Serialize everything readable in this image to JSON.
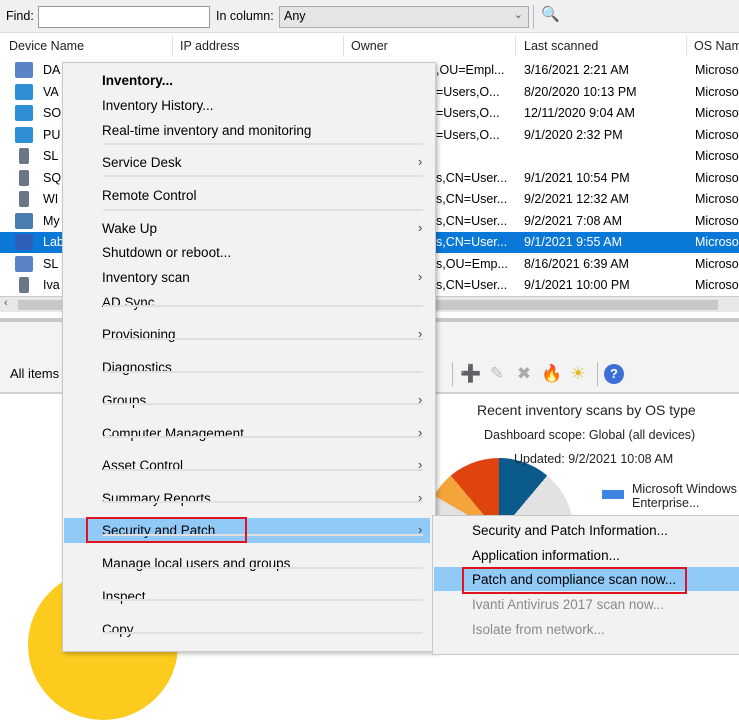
{
  "findbar": {
    "find_label": "Find:",
    "find_value": "",
    "column_label": "In column:",
    "column_value": "Any"
  },
  "columns": [
    "Device Name",
    "IP address",
    "Owner",
    "Last scanned",
    "OS Name"
  ],
  "rows": [
    {
      "name": "DA",
      "owner": ",OU=Empl...",
      "scanned": "3/16/2021 2:21 AM",
      "os": "Microsof",
      "icon": "laptop"
    },
    {
      "name": "VA",
      "owner": "=Users,O...",
      "scanned": "8/20/2020 10:13 PM",
      "os": "Microsof",
      "icon": "desktop"
    },
    {
      "name": "SO",
      "owner": "=Users,O...",
      "scanned": "12/11/2020 9:04 AM",
      "os": "Microsof",
      "icon": "desktop"
    },
    {
      "name": "PU",
      "owner": "=Users,O...",
      "scanned": "9/1/2020 2:32 PM",
      "os": "Microsof",
      "icon": "desktop"
    },
    {
      "name": "SL",
      "owner": "",
      "scanned": "",
      "os": "Microsof",
      "icon": "server"
    },
    {
      "name": "SQ",
      "owner": "s,CN=User...",
      "scanned": "9/1/2021 10:54 PM",
      "os": "Microsof",
      "icon": "server"
    },
    {
      "name": "WI",
      "owner": "s,CN=User...",
      "scanned": "9/2/2021 12:32 AM",
      "os": "Microsof",
      "icon": "server"
    },
    {
      "name": "My",
      "owner": "s,CN=User...",
      "scanned": "9/2/2021 7:08 AM",
      "os": "Microsof",
      "icon": "virtual"
    },
    {
      "name": "Lab",
      "owner": "s,CN=User...",
      "scanned": "9/1/2021 9:55 AM",
      "os": "Microsof",
      "icon": "network",
      "selected": true
    },
    {
      "name": "SL",
      "owner": "s,OU=Emp...",
      "scanned": "8/16/2021 6:39 AM",
      "os": "Microsof",
      "icon": "laptop"
    },
    {
      "name": "Iva",
      "owner": "s,CN=User...",
      "scanned": "9/1/2021 10:00 PM",
      "os": "Microsof",
      "icon": "server"
    }
  ],
  "toolbar": {
    "all_items": "All items"
  },
  "dashboard": {
    "title": "Recent inventory scans by OS type",
    "scope": "Dashboard scope: Global (all devices)",
    "updated": "Updated: 9/2/2021 10:08 AM",
    "legend": [
      "Microsoft Windows",
      "Enterprise..."
    ]
  },
  "menu": {
    "items": [
      "Inventory...",
      "Inventory History...",
      "Real-time inventory and monitoring",
      "Service Desk",
      "Remote Control",
      "Wake Up",
      "Shutdown or reboot...",
      "Inventory scan",
      "AD Sync",
      "Provisioning",
      "Diagnostics",
      "Groups",
      "Computer Management",
      "Asset Control",
      "Summary Reports",
      "Security and Patch",
      "Manage local users and groups",
      "Inspect",
      "Copy"
    ]
  },
  "submenu": {
    "items": [
      "Security and Patch Information...",
      "Application information...",
      "Patch and compliance scan now...",
      "Ivanti Antivirus 2017 scan now...",
      "Isolate from network..."
    ]
  },
  "colors": {
    "selection": "#0a78d7",
    "menu_highlight": "#91c9f7",
    "annotation": "#e0121e"
  }
}
